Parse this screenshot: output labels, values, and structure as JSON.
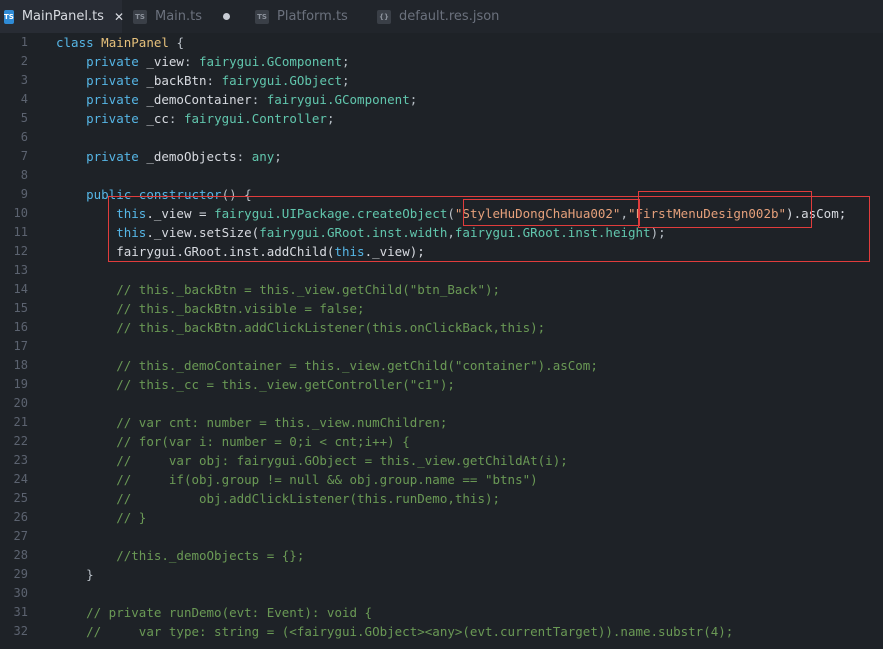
{
  "tabs": [
    {
      "label": "MainPanel.ts",
      "icon": "ts-file-icon",
      "active": true,
      "close": "✕"
    },
    {
      "label": "Main.ts",
      "icon": "ts-file-icon",
      "dirty": true
    },
    {
      "label": "Platform.ts",
      "icon": "ts-file-icon"
    },
    {
      "label": "default.res.json",
      "icon": "json-file-icon"
    }
  ],
  "line_numbers": [
    "1",
    "2",
    "3",
    "4",
    "5",
    "6",
    "7",
    "8",
    "9",
    "10",
    "11",
    "12",
    "13",
    "14",
    "15",
    "16",
    "17",
    "18",
    "19",
    "20",
    "21",
    "22",
    "23",
    "24",
    "25",
    "26",
    "27",
    "28",
    "29",
    "30",
    "31",
    "32"
  ],
  "code": {
    "l1": [
      "class",
      "MainPanel",
      "{"
    ],
    "l2": [
      "private",
      "_view",
      ":",
      "fairygui.GComponent",
      ";"
    ],
    "l3": [
      "private",
      "_backBtn",
      ":",
      "fairygui.GObject",
      ";"
    ],
    "l4": [
      "private",
      "_demoContainer",
      ":",
      "fairygui.GComponent",
      ";"
    ],
    "l5": [
      "private",
      "_cc",
      ":",
      "fairygui.Controller",
      ";"
    ],
    "l7": [
      "private",
      "_demoObjects",
      ":",
      "any",
      ";"
    ],
    "l9": [
      "public",
      "constructor",
      "() {"
    ],
    "l10": [
      "this",
      "._view = ",
      "fairygui.UIPackage.createObject",
      "(",
      "\"StyleHuDongChaHua002\"",
      ",",
      "\"FirstMenuDesign002b\"",
      ").asCom;"
    ],
    "l11": [
      "this",
      "._view.setSize(",
      "fairygui.GRoot.inst.width",
      ",",
      "fairygui.GRoot.inst.height",
      ");"
    ],
    "l12": [
      "fairygui.GRoot.inst.addChild(",
      "this",
      "._view);"
    ],
    "l14": "// this._backBtn = this._view.getChild(\"btn_Back\");",
    "l15": "// this._backBtn.visible = false;",
    "l16": "// this._backBtn.addClickListener(this.onClickBack,this);",
    "l18": "// this._demoContainer = this._view.getChild(\"container\").asCom;",
    "l19": "// this._cc = this._view.getController(\"c1\");",
    "l21": "// var cnt: number = this._view.numChildren;",
    "l22": "// for(var i: number = 0;i < cnt;i++) {",
    "l23": "//     var obj: fairygui.GObject = this._view.getChildAt(i);",
    "l24": "//     if(obj.group != null && obj.group.name == \"btns\")",
    "l25": "//         obj.addClickListener(this.runDemo,this);",
    "l26": "// }",
    "l28": "//this._demoObjects = {};",
    "l29": "}",
    "l31": "// private runDemo(evt: Event): void {",
    "l32": "//     var type: string = (<fairygui.GObject><any>(evt.currentTarget)).name.substr(4);"
  },
  "colors": {
    "highlight_border": "#e03c3c",
    "keyword": "#56b6e6",
    "string": "#e5a07b",
    "comment": "#6a9955"
  }
}
